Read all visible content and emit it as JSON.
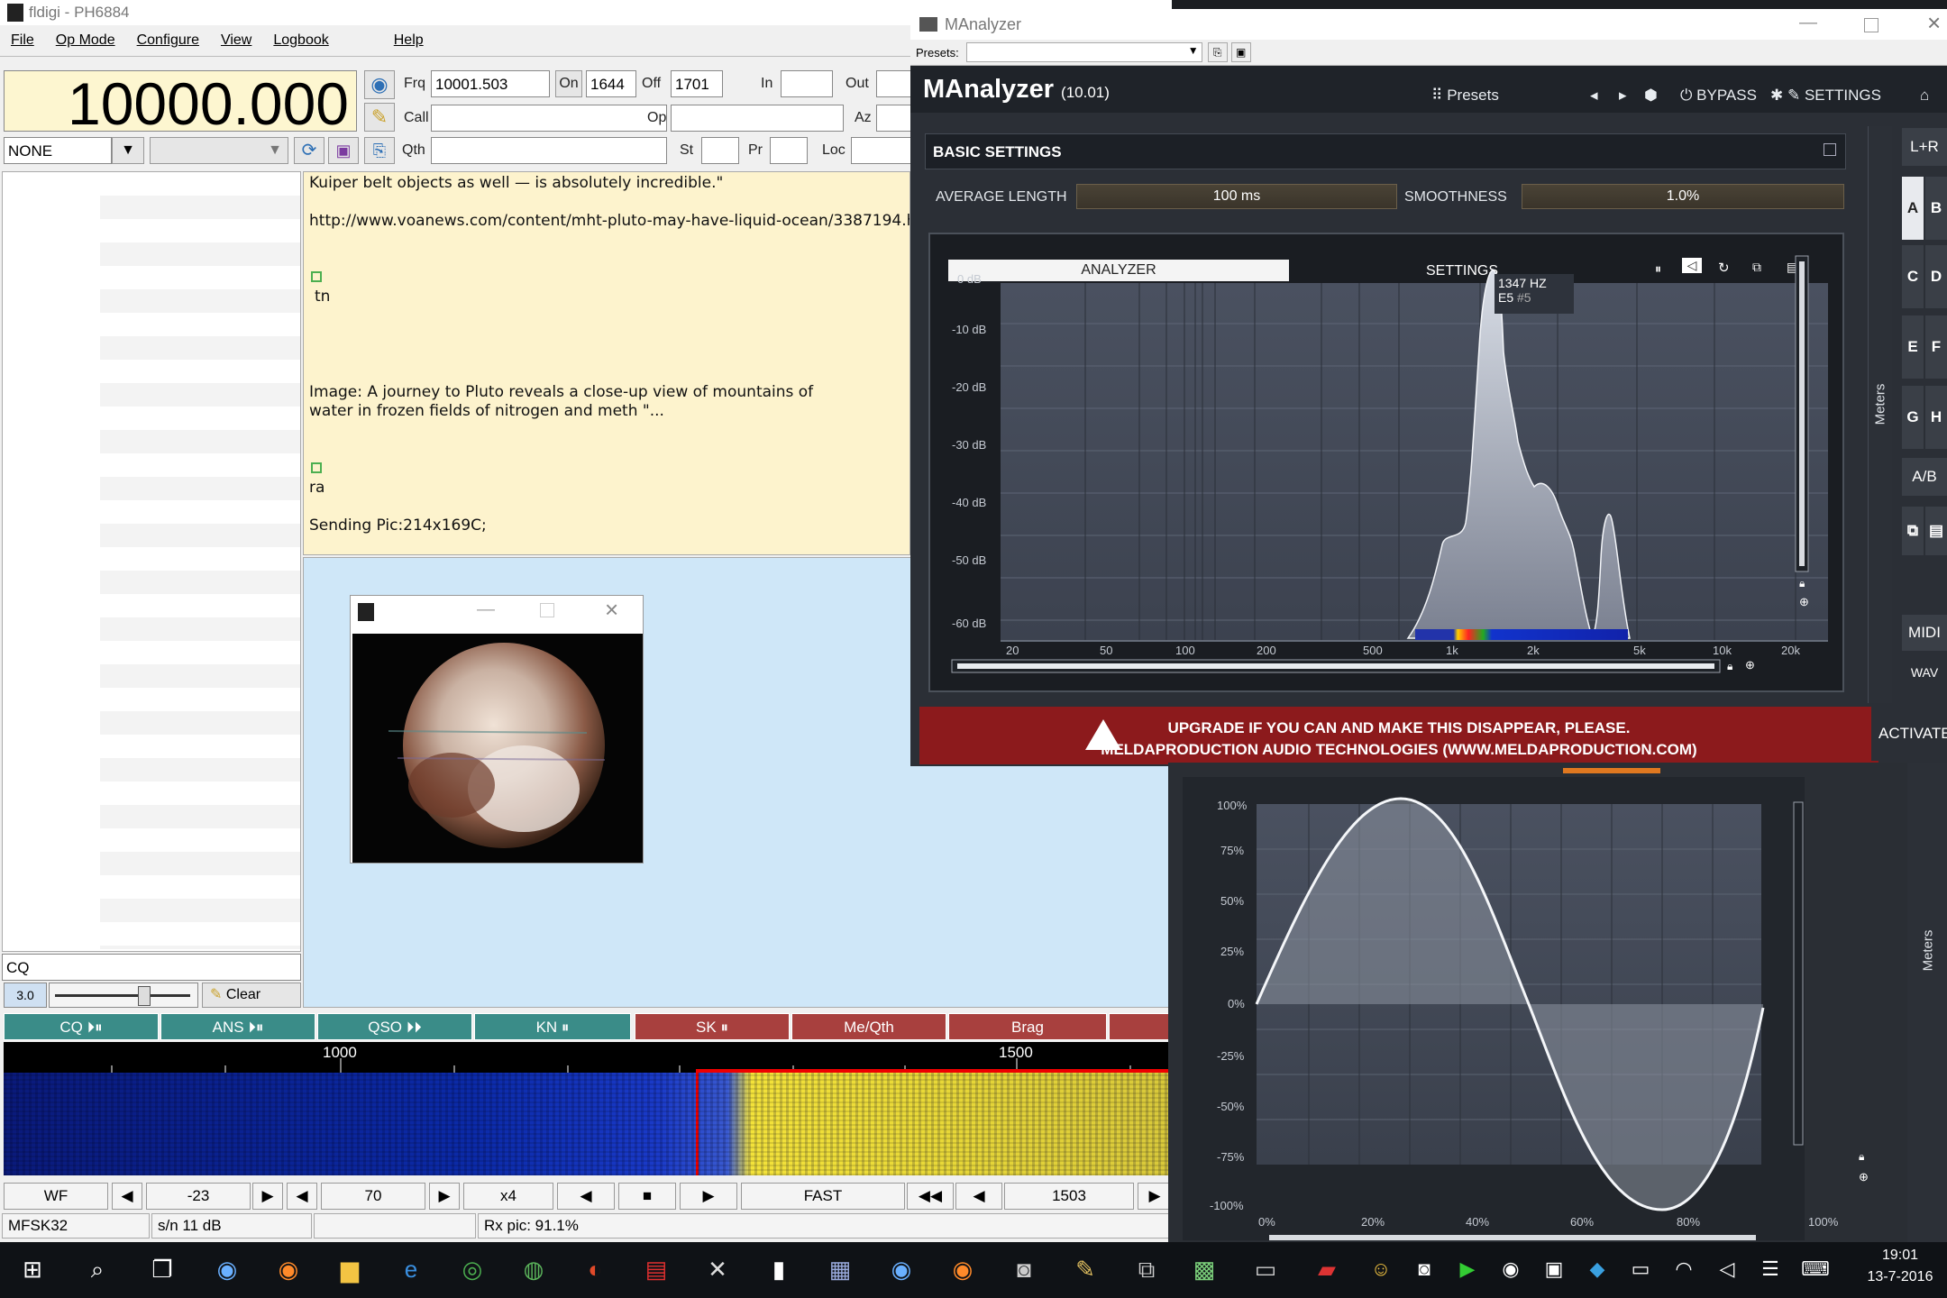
{
  "fldigi": {
    "title": "fldigi - PH6884",
    "menu": [
      "File",
      "Op Mode",
      "Configure",
      "View",
      "Logbook",
      "Help"
    ],
    "frequency_display": "10000.000",
    "fields": {
      "frq_label": "Frq",
      "frq_value": "10001.503",
      "on_label": "On",
      "on_value": "1644",
      "off_label": "Off",
      "off_value": "1701",
      "in_label": "In",
      "out_label": "Out",
      "call_label": "Call",
      "op_label": "Op",
      "az_label": "Az",
      "qth_label": "Qth",
      "st_label": "St",
      "pr_label": "Pr",
      "loc_label": "Loc"
    },
    "mode_select": "NONE",
    "rx_text": {
      "line1": "Kuiper belt objects as well — is absolutely incredible.\"",
      "line2": "http://www.voanews.com/content/mht-pluto-may-have-liquid-ocean/3387194.h",
      "line3": "tn",
      "line4": "Image: A journey to Pluto reveals a close-up view of mountains of",
      "line5": "water in frozen fields of nitrogen and meth \"...",
      "line6": "ra",
      "line7": "Sending Pic:214x169C;"
    },
    "cq_field": "CQ",
    "squelch_value": "3.0",
    "clear_label": "Clear",
    "macros": [
      "CQ ⏵⏸",
      "ANS ⏵⏸",
      "QSO ⏵⏵",
      "KN ⏸",
      "SK ⏸",
      "Me/Qth",
      "Brag"
    ],
    "waterfall_scale": [
      "1000",
      "1500"
    ],
    "controls": {
      "wf": "WF",
      "level": "-23",
      "range": "70",
      "zoom": "x4",
      "speed": "FAST",
      "carrier": "1503"
    },
    "status": {
      "mode": "MFSK32",
      "snr": "s/n  11 dB",
      "rx": "Rx pic: 91.1%"
    }
  },
  "manalyzer": {
    "window_title": "MAnalyzer",
    "presets_label": "Presets:",
    "plugin_name": "MAnalyzer",
    "version": "(10.01)",
    "header_presets": "Presets",
    "bypass": "BYPASS",
    "settings": "SETTINGS",
    "basic_settings": "BASIC SETTINGS",
    "average_length_label": "AVERAGE LENGTH",
    "average_length_value": "100 ms",
    "smoothness_label": "SMOOTHNESS",
    "smoothness_value": "1.0%",
    "tab_analyzer": "ANALYZER",
    "tab_settings": "SETTINGS",
    "db_ticks": [
      "0 dB",
      "-10 dB",
      "-20 dB",
      "-30 dB",
      "-40 dB",
      "-50 dB",
      "-60 dB"
    ],
    "freq_ticks": [
      "20",
      "50",
      "100",
      "200",
      "500",
      "1k",
      "2k",
      "5k",
      "10k",
      "20k"
    ],
    "tooltip_freq": "1347 HZ",
    "tooltip_note": "E5",
    "tooltip_extra": "#5",
    "side_buttons": [
      "L+R",
      "A",
      "B",
      "C",
      "D",
      "E",
      "F",
      "G",
      "H",
      "A/B",
      "MIDI",
      "WAV"
    ],
    "meters_label": "Meters",
    "banner_line1": "UPGRADE IF YOU CAN AND MAKE THIS DISAPPEAR, PLEASE.",
    "banner_line2": "MELDAPRODUCTION AUDIO TECHNOLOGIES (WWW.MELDAPRODUCTION.COM)",
    "activate": "ACTIVATE"
  },
  "oscilloscope": {
    "y_ticks": [
      "100%",
      "75%",
      "50%",
      "25%",
      "0%",
      "-25%",
      "-50%",
      "-75%",
      "-100%"
    ],
    "x_ticks": [
      "0%",
      "20%",
      "40%",
      "60%",
      "80%",
      "100%"
    ],
    "meters_label": "Meters"
  },
  "taskbar": {
    "time": "19:01",
    "date": "13-7-2016"
  }
}
